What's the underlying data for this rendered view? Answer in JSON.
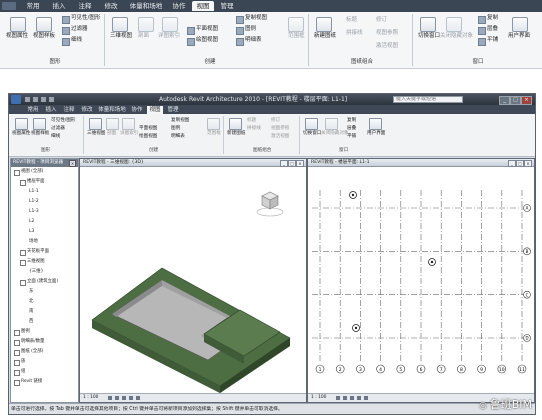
{
  "top_ribbon": {
    "tabs": [
      "常用",
      "插入",
      "注释",
      "修改",
      "体量和场地",
      "协作",
      "视图",
      "管理"
    ],
    "active_tab": "视图",
    "graphics_group": {
      "label": "图形",
      "items": [
        "视图属性",
        "视图样板",
        "可见性/图形",
        "过滤器",
        "细线"
      ]
    },
    "create_group": {
      "label": "创建",
      "items": [
        "三维视图",
        "剖面",
        "详图索引",
        "平面视图",
        "绘图视图",
        "复制视图",
        "图例",
        "明细表",
        "范围框"
      ]
    },
    "sheet_group": {
      "label": "图纸组合",
      "items": [
        "新建图纸",
        "标题",
        "拼接线",
        "修订",
        "视图参照",
        "激活视图"
      ]
    },
    "window_group": {
      "label": "窗口",
      "items": [
        "切换窗口",
        "关闭隐藏对象",
        "复制",
        "层叠",
        "平铺",
        "用户界面"
      ]
    }
  },
  "app": {
    "title": "Autodesk Revit Architecture 2010 - [REVIT教程 - 楼层平面: L1-1]",
    "search_placeholder": "键入关键字或短语",
    "tabs": [
      "常用",
      "插入",
      "注释",
      "修改",
      "体量和场地",
      "协作",
      "视图",
      "管理"
    ],
    "active_tab": "视图",
    "ribbon_items": [
      "视图属性",
      "视图样板",
      "可见性/图形",
      "过滤器",
      "细线",
      "三维视图",
      "剖面",
      "详图索引",
      "平面视图",
      "绘图视图",
      "复制视图",
      "图例",
      "明细表",
      "范围框",
      "新建图纸",
      "标题",
      "拼接线",
      "修订",
      "视图参照",
      "激活视图",
      "切换窗口",
      "关闭隐藏对象",
      "复制",
      "层叠",
      "平铺",
      "用户界面"
    ],
    "ribbon_groups": [
      "图形",
      "创建",
      "图纸组合",
      "窗口"
    ],
    "project_browser": {
      "title": "REVIT教程 - 项目浏览器",
      "tree": [
        "视图 (全部)",
        "楼层平面",
        "L1-1",
        "L1-2",
        "L1-3",
        "L2",
        "L3",
        "场地",
        "天花板平面",
        "三维视图",
        "{三维}",
        "立面 (建筑立面)",
        "东",
        "北",
        "南",
        "西",
        "图例",
        "明细表/数量",
        "图纸 (全部)",
        "族",
        "组",
        "Revit 链接"
      ]
    },
    "view_3d_title": "REVIT教程 - 三维视图: {3D}",
    "view_plan_title": "REVIT教程 - 楼层平面: L1-1",
    "view_3d_scale": "1 : 100",
    "view_plan_scale": "1 : 100",
    "grid_labels_bottom": [
      "1",
      "2",
      "3",
      "4",
      "5",
      "6",
      "7",
      "8",
      "9",
      "10",
      "11"
    ],
    "grid_labels_side": [
      "A",
      "B",
      "C",
      "D"
    ],
    "status_text": "单击可进行选择，按 Tab 键并单击可选择其他项目；按 Ctrl 键并单击可将新项目添加到选择集；按 Shift 键并单击可取消选择。"
  },
  "watermark": "鲁班BIM",
  "colors": {
    "title_bar": "#2c333c",
    "tab_bar": "#3e4856",
    "model_green": "#4d6e43",
    "model_floor": "#b7b7b7"
  }
}
